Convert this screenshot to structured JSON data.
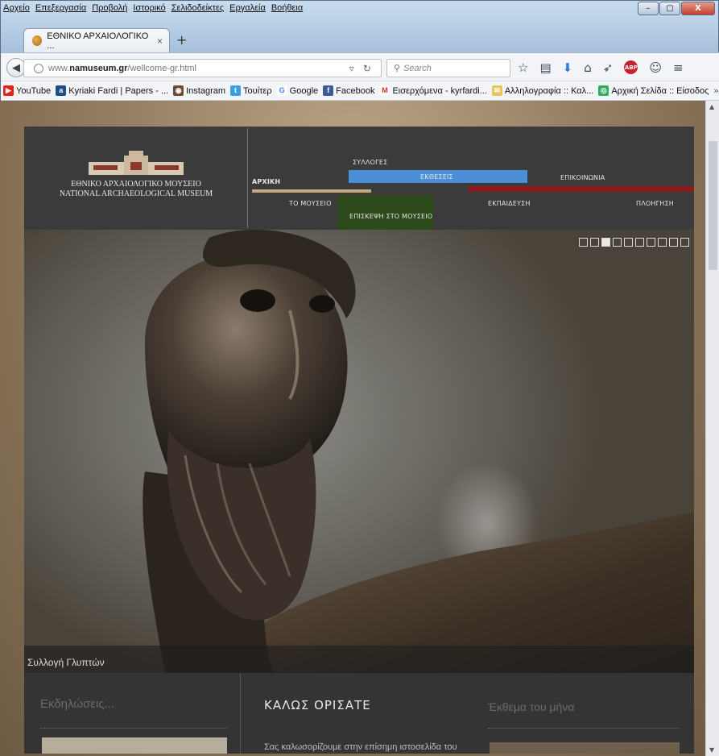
{
  "menubar": {
    "items": [
      "Αρχείο",
      "Επεξεργασία",
      "Προβολή",
      "Ιστορικό",
      "Σελιδοδείκτες",
      "Εργαλεία",
      "Βοήθεια"
    ]
  },
  "window_buttons": {
    "minimize": "–",
    "maximize": "▢",
    "close": "X"
  },
  "tab": {
    "title": "ΕΘΝΙΚΟ ΑΡΧΑΙΟΛΟΓΙΚΟ ...",
    "close": "×",
    "new_tab": "+"
  },
  "url": {
    "prefix": "www.",
    "domain": "namuseum.gr",
    "path": "/wellcome-gr.html"
  },
  "search": {
    "placeholder": "Search"
  },
  "bookmarks": [
    {
      "label": "YouTube",
      "icon": "youtube-icon",
      "color": "#e62117",
      "glyph": "▶"
    },
    {
      "label": "Kyriaki Fardi | Papers - ...",
      "icon": "academia-icon",
      "color": "#1f4f86",
      "glyph": "a"
    },
    {
      "label": "Instagram",
      "icon": "instagram-icon",
      "color": "#6b4a33",
      "glyph": "◉"
    },
    {
      "label": "Τουίτερ",
      "icon": "twitter-icon",
      "color": "#3a9fe0",
      "glyph": "t"
    },
    {
      "label": "Google",
      "icon": "google-icon",
      "color": "#ffffff",
      "glyph": "G"
    },
    {
      "label": "Facebook",
      "icon": "facebook-icon",
      "color": "#3b5998",
      "glyph": "f"
    },
    {
      "label": "Εισερχόμενα - kyrfardi...",
      "icon": "gmail-icon",
      "color": "#ffffff",
      "glyph": "M"
    },
    {
      "label": "Αλληλογραφία :: Καλ...",
      "icon": "mail-icon",
      "color": "#e6c35c",
      "glyph": "✉"
    },
    {
      "label": "Αρχική Σελίδα :: Είσοδος",
      "icon": "site-icon",
      "color": "#2fae62",
      "glyph": "◎"
    }
  ],
  "bookmarks_more": "»",
  "site": {
    "logo_line1": "ΕΘΝΙΚΟ ΑΡΧΑΙΟΛΟΓΙΚΟ ΜΟΥΣΕΙΟ",
    "logo_line2": "NATIONAL ARCHAEOLOGICAL MUSEUM",
    "nav": {
      "home": "ΑΡΧΙΚΗ",
      "collections": "ΣΥΛΛΟΓΕΣ",
      "exhibitions": "ΕΚΘΕΣΕΙΣ",
      "contact": "ΕΠΙΚΟΙΝΩΝΙΑ",
      "museum": "ΤΟ ΜΟΥΣΕΙΟ",
      "visit": "ΕΠΙΣΚΕΨΗ ΣΤΟ ΜΟΥΣΕΙΟ",
      "education": "ΕΚΠΑΙΔΕΥΣΗ",
      "navigation": "ΠΛΟΗΓΗΣΗ"
    },
    "colors": {
      "tan": "#c8a87a",
      "blue": "#4a8fd8",
      "red": "#8b1a1a",
      "green": "#2d4a1b",
      "header": "#3b3b3b"
    },
    "slider": {
      "count": 10,
      "active_index": 2
    },
    "hero_caption": "Συλλογή Γλυπτών",
    "events_title": "Εκδηλώσεις...",
    "welcome_title": "ΚΑΛΩΣ ΟΡΙΣΑΤΕ",
    "welcome_text": "Σας καλωσορίζουμε στην επίσημη ιστοσελίδα του",
    "exhibit_title": "Έκθεμα του μήνα"
  }
}
